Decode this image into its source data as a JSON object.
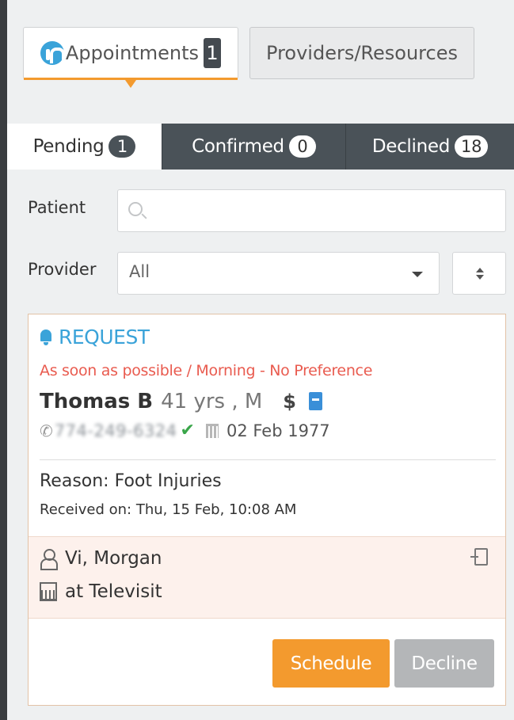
{
  "top_tabs": {
    "appointments": {
      "label": "Appointments",
      "count": "1"
    },
    "providers": {
      "label": "Providers/Resources"
    }
  },
  "status_tabs": [
    {
      "label": "Pending",
      "count": "1"
    },
    {
      "label": "Confirmed",
      "count": "0"
    },
    {
      "label": "Declined",
      "count": "18"
    }
  ],
  "filters": {
    "patient_label": "Patient",
    "patient_value": "",
    "provider_label": "Provider",
    "provider_value": "All"
  },
  "request": {
    "type": "REQUEST",
    "preference": "As soon as possible / Morning - No Preference",
    "patient_name": "Thomas B",
    "age_sex": "41 yrs , M",
    "dollar": "$",
    "phone": "774-249-6324",
    "dob": "02 Feb 1977",
    "reason": "Reason: Foot Injuries",
    "received": "Received on: Thu, 15 Feb, 10:08 AM",
    "provider_name": "Vi, Morgan",
    "location": "at Televisit"
  },
  "actions": {
    "schedule": "Schedule",
    "decline": "Decline"
  },
  "colors": {
    "accent_orange": "#f39a2e",
    "accent_blue": "#3aa3d9",
    "preference_red": "#e95b4f",
    "tab_dark": "#4a5258",
    "verified_green": "#3aa64a"
  }
}
